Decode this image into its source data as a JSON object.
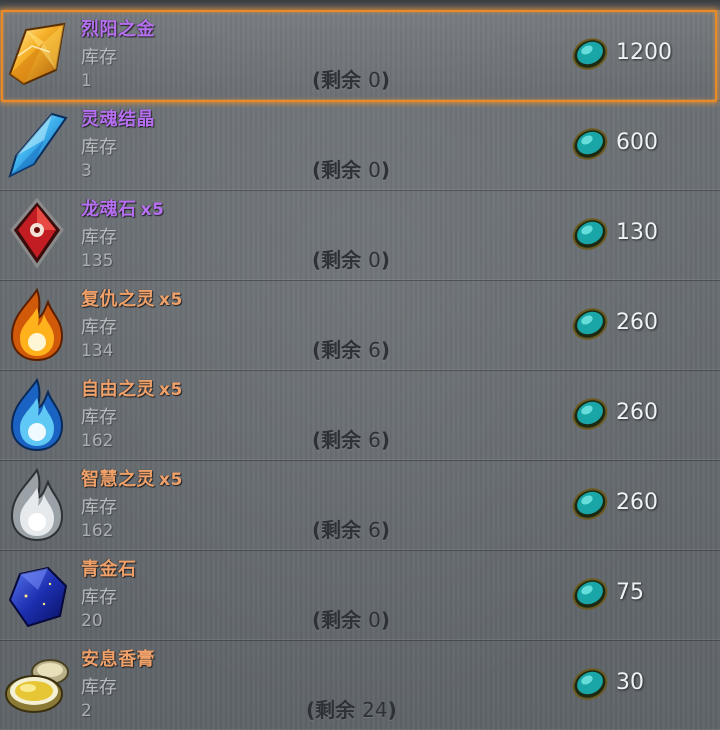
{
  "items": [
    {
      "name": "烈阳之金",
      "qty": "",
      "stock_label": "库存",
      "stock": "1",
      "remaining_prefix": "(剩余",
      "remaining_value": "0",
      "remaining_suffix": ")",
      "price": "1200",
      "icon": "golden-crystal-icon",
      "name_color": "#b66ff0"
    },
    {
      "name": "灵魂结晶",
      "qty": "",
      "stock_label": "库存",
      "stock": "3",
      "remaining_prefix": "(剩余",
      "remaining_value": "0",
      "remaining_suffix": ")",
      "price": "600",
      "icon": "blue-crystal-icon",
      "name_color": "#b66ff0"
    },
    {
      "name": "龙魂石",
      "qty": "x5",
      "stock_label": "库存",
      "stock": "135",
      "remaining_prefix": "(剩余",
      "remaining_value": "0",
      "remaining_suffix": ")",
      "price": "130",
      "icon": "red-dragon-gem-icon",
      "name_color": "#b66ff0"
    },
    {
      "name": "复仇之灵",
      "qty": "x5",
      "stock_label": "库存",
      "stock": "134",
      "remaining_prefix": "(剩余",
      "remaining_value": "6",
      "remaining_suffix": ")",
      "price": "260",
      "icon": "fire-spirit-icon",
      "name_color": "#f0a16a"
    },
    {
      "name": "自由之灵",
      "qty": "x5",
      "stock_label": "库存",
      "stock": "162",
      "remaining_prefix": "(剩余",
      "remaining_value": "6",
      "remaining_suffix": ")",
      "price": "260",
      "icon": "blue-flame-spirit-icon",
      "name_color": "#f0a16a"
    },
    {
      "name": "智慧之灵",
      "qty": "x5",
      "stock_label": "库存",
      "stock": "162",
      "remaining_prefix": "(剩余",
      "remaining_value": "6",
      "remaining_suffix": ")",
      "price": "260",
      "icon": "white-flame-spirit-icon",
      "name_color": "#f0a16a"
    },
    {
      "name": "青金石",
      "qty": "",
      "stock_label": "库存",
      "stock": "20",
      "remaining_prefix": "(剩余",
      "remaining_value": "0",
      "remaining_suffix": ")",
      "price": "75",
      "icon": "lapis-lazuli-icon",
      "name_color": "#f0a16a"
    },
    {
      "name": "安息香膏",
      "qty": "",
      "stock_label": "库存",
      "stock": "2",
      "remaining_prefix": "(剩余",
      "remaining_value": "24",
      "remaining_suffix": ")",
      "price": "30",
      "icon": "balm-tin-icon",
      "name_color": "#f0a16a"
    }
  ],
  "currency_icon": "turquoise-gem-icon",
  "selected_index": 0,
  "colors": {
    "selection": "#e88a25",
    "rare": "#b66ff0",
    "uncommon": "#f0a16a",
    "price": "#eef2f4"
  }
}
